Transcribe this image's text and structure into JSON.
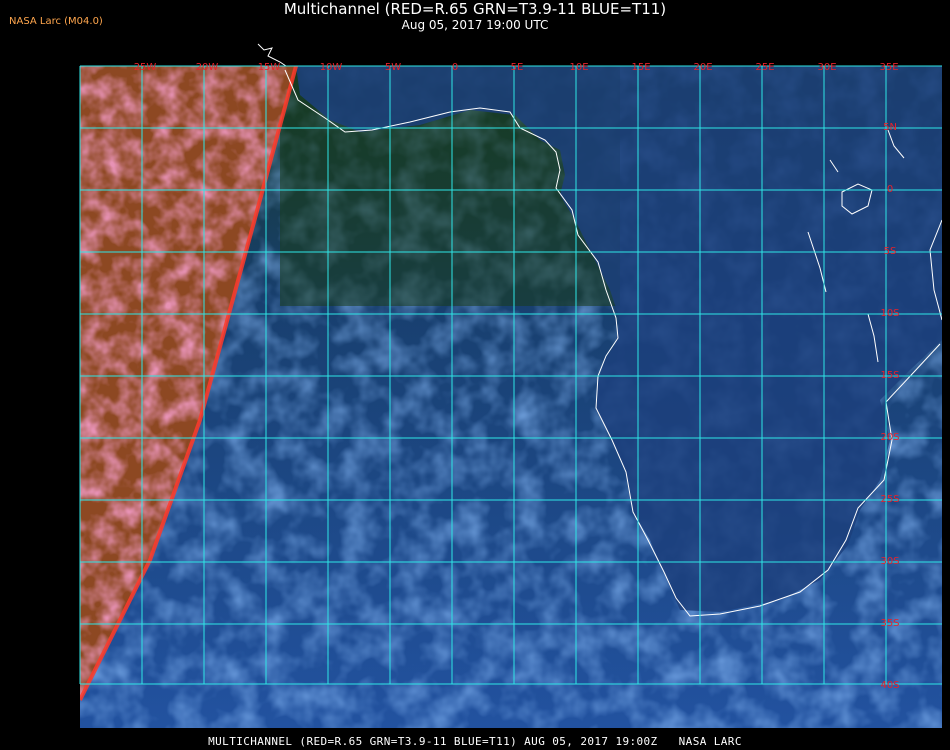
{
  "header": {
    "credit": "NASA Larc (M04.0)",
    "title": "Multichannel (RED=R.65 GRN=T3.9-11 BLUE=T11)",
    "subtitle": "Aug 05, 2017 19:00 UTC"
  },
  "footer": {
    "caption": "MULTICHANNEL (RED=R.65 GRN=T3.9-11 BLUE=T11) AUG 05, 2017 19:00Z   NASA LARC"
  },
  "map": {
    "lon_labels": [
      "25W",
      "20W",
      "15W",
      "10W",
      "5W",
      "0",
      "5E",
      "10E",
      "15E",
      "20E",
      "25E",
      "30E",
      "35E"
    ],
    "lat_labels": [
      "5N",
      "0",
      "5S",
      "10S",
      "15S",
      "20S",
      "25S",
      "30S",
      "35S",
      "40S"
    ],
    "colors": {
      "grid": "#2ee6e6",
      "coastline": "#ffffff",
      "label": "#e8212a",
      "ocean_blue": "#1f4a8c",
      "cloud_blue": "#3f7fd6",
      "land_dark": "#1b3a18",
      "reflectance_pink": "#e06ad2",
      "reflectance_red": "#c8442e"
    }
  }
}
